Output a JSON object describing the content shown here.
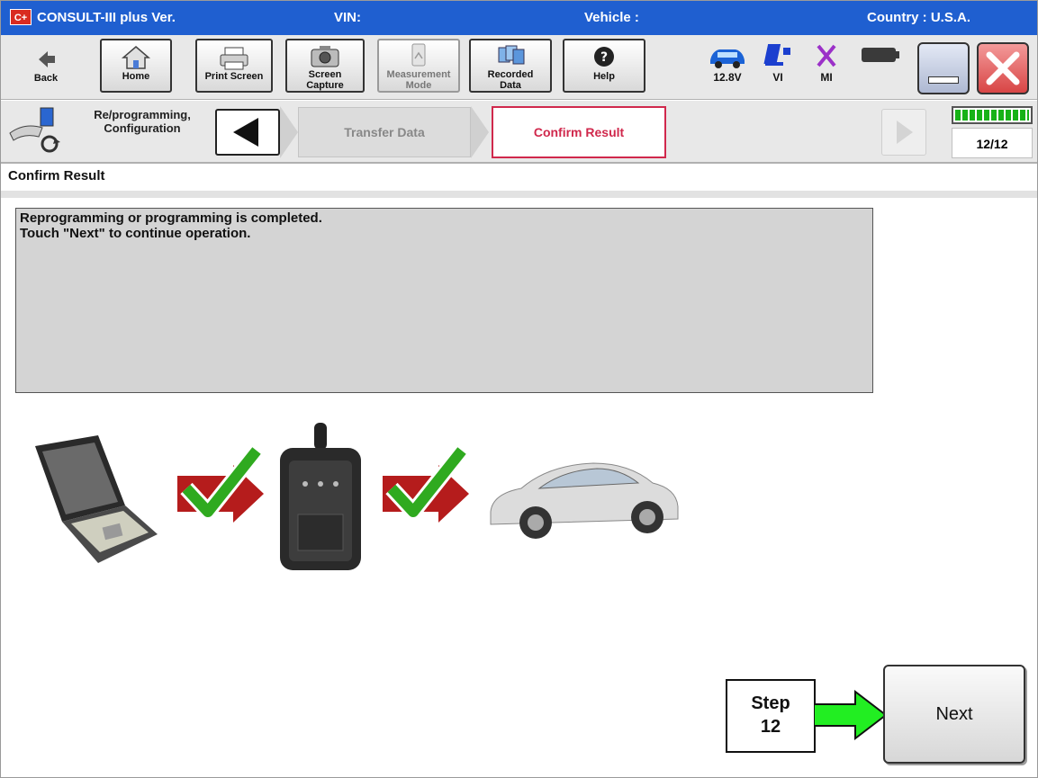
{
  "title_bar": {
    "app_version_label": "CONSULT-III plus  Ver.",
    "vin_label": "VIN:",
    "vehicle_label": "Vehicle :",
    "country_label": "Country : U.S.A.",
    "logo_text": "C+"
  },
  "toolbar": {
    "back_label": "Back",
    "home_label": "Home",
    "print_label": "Print Screen",
    "capture_label_line1": "Screen",
    "capture_label_line2": "Capture",
    "measurement_label_line1": "Measurement",
    "measurement_label_line2": "Mode",
    "recorded_label_line1": "Recorded",
    "recorded_label_line2": "Data",
    "help_label": "Help",
    "voltage_label": "12.8V",
    "vi_label": "VI",
    "mi_label": "MI"
  },
  "breadcrumb": {
    "section_line1": "Re/programming,",
    "section_line2": "Configuration",
    "prev_step": "Transfer Data",
    "current_step": "Confirm Result",
    "page_count": "12/12",
    "progress_fraction": 1.0
  },
  "main": {
    "section_title": "Confirm Result",
    "message_line1": "Reprogramming or programming is completed.",
    "message_line2": "Touch \"Next\" to continue operation."
  },
  "callout": {
    "line1": "Step",
    "line2": "12"
  },
  "next_button": {
    "label": "Next"
  },
  "colors": {
    "title_bar": "#1f5fd0",
    "active_step": "#d0284c",
    "arrow_green": "#22ee22",
    "check_green": "#2faa1f",
    "flow_red": "#b51c1c",
    "progress_green": "#17b217"
  }
}
